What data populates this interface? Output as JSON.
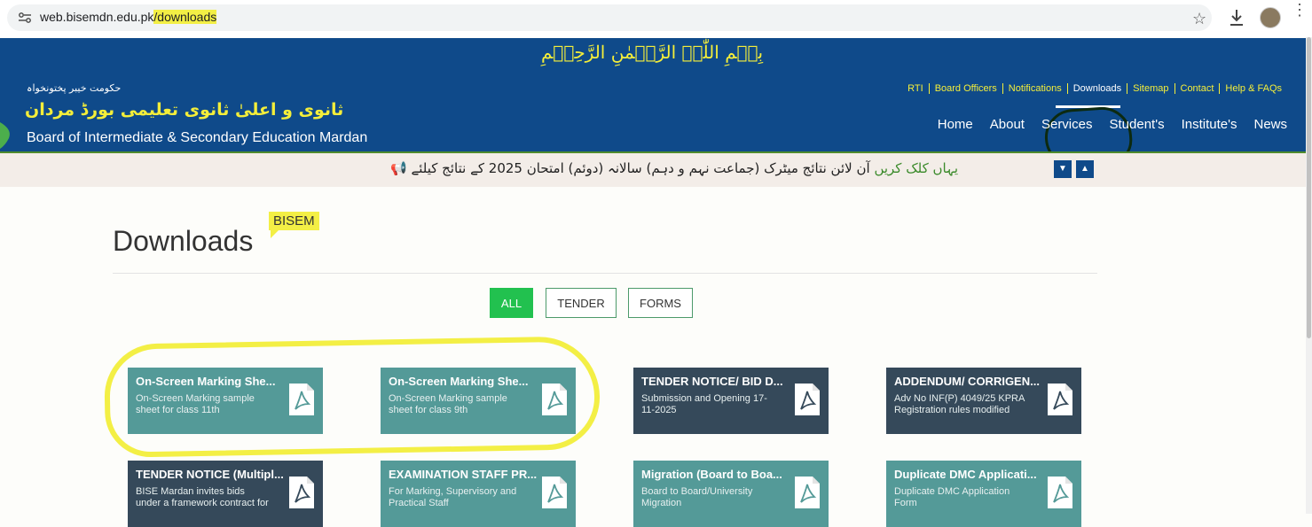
{
  "browser": {
    "url_base": "web.bisemdn.edu.pk",
    "url_path": "/downloads"
  },
  "header": {
    "bismillah": "بِسۡمِ اللّٰہِ الرَّحۡمٰنِ الرَّحِیۡمِ",
    "urdu_small": "حکومت خیبر پختونخواہ",
    "urdu_big": "ثانوی و اعلیٰ ثانوی تعلیمی بورڈ مردان",
    "board_name": "Board of Intermediate & Secondary Education Mardan",
    "top_links": [
      "RTI",
      "Board Officers",
      "Notifications",
      "Downloads",
      "Sitemap",
      "Contact",
      "Help & FAQs"
    ],
    "active_link": "Downloads",
    "main_nav": [
      "Home",
      "About",
      "Services",
      "Student's",
      "Institute's",
      "News"
    ],
    "colors": {
      "header_bg": "#0f4a8a",
      "accent_yellow": "#f4ee3a"
    }
  },
  "ticker": {
    "text": "آن لائن نتائج میٹرک (جماعت نہم و دہم) سالانہ (دوئم) امتحان 2025 کے نتائج کیلئے",
    "link": "یہاں کلک کریں"
  },
  "page": {
    "title": "Downloads",
    "tag": "BISEM",
    "filters": [
      "ALL",
      "TENDER",
      "FORMS"
    ],
    "active_filter": "ALL"
  },
  "cards": [
    {
      "title": "On-Screen Marking She...",
      "desc": "On-Screen Marking sample sheet for class 11th",
      "color": "teal"
    },
    {
      "title": "On-Screen Marking She...",
      "desc": "On-Screen Marking sample sheet for class 9th",
      "color": "teal"
    },
    {
      "title": "TENDER NOTICE/ BID D...",
      "desc": "Submission and Opening 17-11-2025",
      "color": "dark"
    },
    {
      "title": "ADDENDUM/ CORRIGEN...",
      "desc": "Adv No INF(P) 4049/25 KPRA Registration rules modified",
      "color": "dark"
    },
    {
      "title": "TENDER NOTICE (Multipl...",
      "desc": "BISE Mardan invites bids under a framework contract for",
      "color": "dark"
    },
    {
      "title": "EXAMINATION STAFF PR...",
      "desc": "For Marking, Supervisory and Practical Staff",
      "color": "teal"
    },
    {
      "title": "Migration (Board to Boa...",
      "desc": "Board to Board/University Migration",
      "color": "teal"
    },
    {
      "title": "Duplicate DMC Applicati...",
      "desc": "Duplicate DMC Application Form",
      "color": "teal"
    }
  ]
}
